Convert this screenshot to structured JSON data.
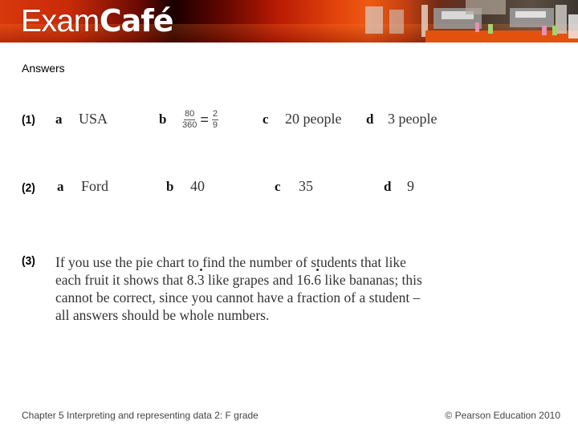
{
  "banner": {
    "logo_light": "Exam",
    "logo_bold": "Café"
  },
  "section_title": "Answers",
  "questions": [
    {
      "number": "(1)",
      "parts": [
        {
          "letter": "a",
          "answer": "USA"
        },
        {
          "letter": "b",
          "fraction": {
            "numerator": "80",
            "denominator": "360"
          },
          "equals": "=",
          "result": {
            "numerator": "2",
            "denominator": "9"
          }
        },
        {
          "letter": "c",
          "answer": "20 people"
        },
        {
          "letter": "d",
          "answer": "3 people"
        }
      ]
    },
    {
      "number": "(2)",
      "parts": [
        {
          "letter": "a",
          "answer": "Ford"
        },
        {
          "letter": "b",
          "answer": "40"
        },
        {
          "letter": "c",
          "answer": "35"
        },
        {
          "letter": "d",
          "answer": "9"
        }
      ]
    },
    {
      "number": "(3)",
      "text_lines": [
        "If you use the pie chart to find the number of students that like",
        "each fruit it shows that ",
        " like grapes and ",
        " like bananas; this",
        "cannot be correct, since you cannot have a fraction of a student –",
        "all answers should be whole numbers."
      ],
      "values": {
        "grapes_whole": "8.",
        "grapes_recurring": "3",
        "bananas_whole": "16.",
        "bananas_recurring": "6"
      }
    }
  ],
  "footer": {
    "chapter": "Chapter 5 Interpreting and representing data 2: F grade",
    "copyright": "© Pearson Education 2010"
  }
}
